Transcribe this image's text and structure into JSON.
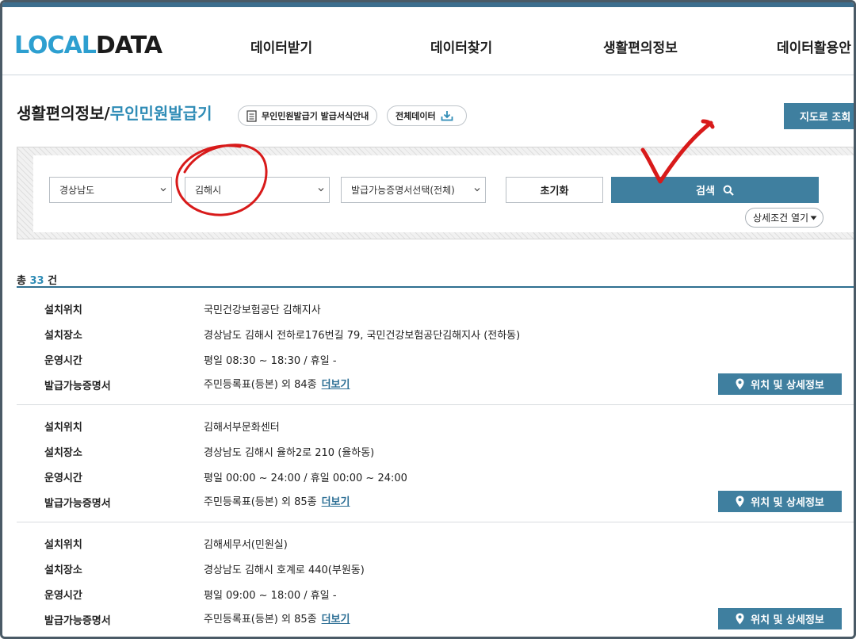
{
  "logo": {
    "part1": "LOCAL",
    "part2": "DATA"
  },
  "nav": [
    "데이터받기",
    "데이터찾기",
    "생활편의정보",
    "데이터활용안"
  ],
  "title": {
    "main": "생활편의정보/",
    "sub": "무인민원발급기"
  },
  "pills": {
    "form_guide": "무인민원발급기 발급서식안내",
    "all_data": "전체데이터"
  },
  "map_button": "지도로 조회",
  "search": {
    "province": "경상남도",
    "city": "김해시",
    "certificate": "발급가능증명서선택(전체)",
    "reset_label": "초기화",
    "search_label": "검색",
    "detail_toggle": "상세조건 열기"
  },
  "total": {
    "prefix": "총",
    "count": "33",
    "suffix": "건"
  },
  "field_labels": {
    "location": "설치위치",
    "place": "설치장소",
    "hours": "운영시간",
    "certificates": "발급가능증명서"
  },
  "more_label": "더보기",
  "detail_button": "위치 및 상세정보",
  "results": [
    {
      "location": "국민건강보험공단 김해지사",
      "place": "경상남도 김해시 전하로176번길 79, 국민건강보험공단김해지사 (전하동)",
      "hours": "평일 08:30 ~ 18:30 / 휴일 -",
      "certificates": "주민등록표(등본) 외 84종"
    },
    {
      "location": "김해서부문화센터",
      "place": "경상남도 김해시 율하2로 210 (율하동)",
      "hours": "평일 00:00 ~ 24:00 / 휴일 00:00 ~ 24:00",
      "certificates": "주민등록표(등본) 외 85종"
    },
    {
      "location": "김해세무서(민원실)",
      "place": "경상남도 김해시 호계로 440(부원동)",
      "hours": "평일 09:00 ~ 18:00 / 휴일 -",
      "certificates": "주민등록표(등본) 외 85종"
    }
  ],
  "colors": {
    "brand_blue": "#2d9fd0",
    "button_blue": "#3f7f9f",
    "accent_text": "#2f8cb6",
    "annotation_red": "#d81a1a"
  }
}
